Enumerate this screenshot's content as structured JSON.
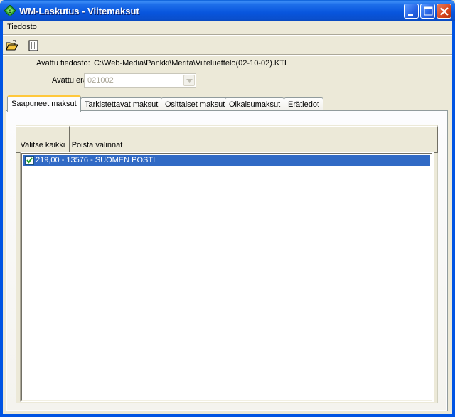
{
  "window": {
    "title": "WM-Laskutus - Viitemaksut",
    "icon": "green-diamond-icon"
  },
  "menu": {
    "items": [
      {
        "label": "Tiedosto"
      }
    ]
  },
  "toolbar": {
    "buttons": [
      {
        "icon": "open-folder-icon"
      },
      {
        "icon": "list-view-icon"
      }
    ]
  },
  "info": {
    "file_label": "Avattu tiedosto:",
    "file_value": "C:\\Web-Media\\Pankki\\Merita\\Viiteluettelo(02-10-02).KTL",
    "batch_label": "Avattu erä:",
    "batch_value": "021002"
  },
  "tabs": [
    {
      "label": "Saapuneet maksut",
      "active": true
    },
    {
      "label": "Tarkistettavat maksut",
      "active": false
    },
    {
      "label": "Osittaiset maksut",
      "active": false
    },
    {
      "label": "Oikaisumaksut",
      "active": false
    },
    {
      "label": "Erätiedot",
      "active": false
    }
  ],
  "panel": {
    "select_all_label": "Valitse kaikki",
    "clear_label": "Poista valinnat",
    "rows": [
      {
        "text": "219,00 - 13576 - SUOMEN POSTI",
        "checked": true,
        "selected": true
      }
    ]
  },
  "colors": {
    "titlebar": "#0855DD",
    "selection": "#316AC5",
    "active_tab_accent": "#FFC83C"
  }
}
